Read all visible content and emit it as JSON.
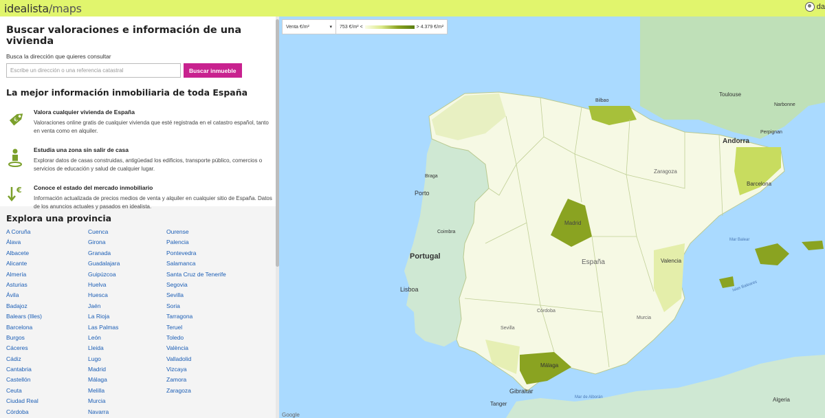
{
  "header": {
    "logo_main": "idealista",
    "logo_sub": "/maps",
    "user": "da"
  },
  "search": {
    "title": "Buscar valoraciones e información de una vivienda",
    "label": "Busca la dirección que quieres consultar",
    "placeholder": "Escribe un dirección o una referencia catastral",
    "button": "Buscar inmueble"
  },
  "info": {
    "title": "La mejor información inmobiliaria de toda España",
    "features": [
      {
        "title": "Valora cualquier vivienda de España",
        "text": "Valoraciones online gratis de cualquier vivienda que esté registrada en el catastro español, tanto en venta como en alquiler.",
        "icon": "price-tag-icon"
      },
      {
        "title": "Estudia una zona sin salir de casa",
        "text": "Explorar datos de casas construidas, antigüedad los edificios, transporte público, comercios o servicios de educación y salud de cualquier lugar.",
        "icon": "person-pin-icon"
      },
      {
        "title": "Conoce el estado del mercado inmobiliario",
        "text": "Información actualizada de precios medios de venta y alquiler en cualquier sitio de España. Datos de los anuncios actuales y pasados en idealista.",
        "icon": "euro-trend-icon"
      }
    ]
  },
  "provinces": {
    "title": "Explora una provincia",
    "items": [
      "A Coruña",
      "Álava",
      "Albacete",
      "Alicante",
      "Almería",
      "Asturias",
      "Ávila",
      "Badajoz",
      "Balears (Illes)",
      "Barcelona",
      "Burgos",
      "Cáceres",
      "Cádiz",
      "Cantabria",
      "Castellón",
      "Ceuta",
      "Ciudad Real",
      "Córdoba",
      "Cuenca",
      "Girona",
      "Granada",
      "Guadalajara",
      "Guipúzcoa",
      "Huelva",
      "Huesca",
      "Jaén",
      "La Rioja",
      "Las Palmas",
      "León",
      "Lleida",
      "Lugo",
      "Madrid",
      "Málaga",
      "Melilla",
      "Murcia",
      "Navarra",
      "Ourense",
      "Palencia",
      "Pontevedra",
      "Salamanca",
      "Santa Cruz de Tenerife",
      "Segovia",
      "Sevilla",
      "Soria",
      "Tarragona",
      "Teruel",
      "Toledo",
      "València",
      "Valladolid",
      "Vizcaya",
      "Zamora",
      "Zaragoza"
    ]
  },
  "map": {
    "legend_select": "Venta €/m²",
    "legend_min": "753 €/m² <",
    "legend_max": "> 4.379 €/m²",
    "labels": [
      "Toulouse",
      "Andorra",
      "Barcelona",
      "Zaragoza",
      "Madrid",
      "España",
      "Valencia",
      "Portugal",
      "Porto",
      "Braga",
      "Coimbra",
      "Lisboa",
      "Málaga",
      "Gibraltar",
      "Tanger",
      "Algeria",
      "Mar Balear",
      "Islas Baleares",
      "Mar de Alborán",
      "Narbonne",
      "Perpignan",
      "Bilbao",
      "Córdoba",
      "Sevilla",
      "Murcia"
    ],
    "attribution": "Google",
    "colors": {
      "sea": "#aadaff",
      "land_out": "#cfe8d3",
      "france": "#bfe0b8",
      "low": "#f6f9e4",
      "mid": "#dbe98a",
      "high": "#8aa321"
    }
  }
}
